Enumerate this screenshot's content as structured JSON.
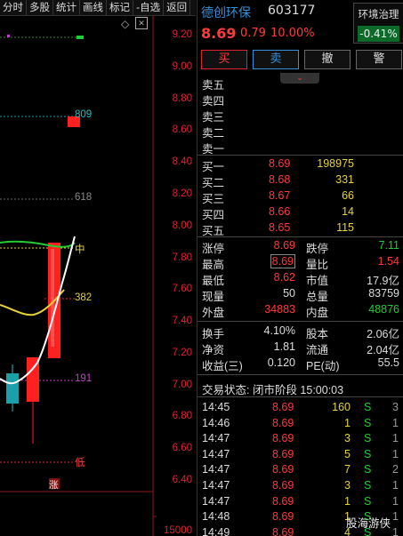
{
  "toolbar": {
    "items": [
      "分时",
      "多股",
      "统计",
      "画线",
      "标记",
      "-自选",
      "返回"
    ]
  },
  "chart": {
    "price_ticks": [
      "9.20",
      "9.00",
      "8.80",
      "8.60",
      "8.40",
      "8.20",
      "8.00",
      "7.80",
      "7.60",
      "7.40",
      "7.20",
      "7.00",
      "6.80",
      "6.60",
      "6.40"
    ],
    "level_labels": {
      "l809": "809",
      "l618": "618",
      "l382": "382",
      "l191": "191",
      "mid": "中",
      "low": "低",
      "rise": "涨"
    },
    "volume_scale": "15000",
    "colors": {
      "up": "#ff2020",
      "down": "#20c0c0",
      "ma_white": "#ffffff",
      "ma_yellow": "#e6d23a",
      "ma_green": "#22cc33"
    }
  },
  "stock": {
    "name": "德创环保",
    "code": "603177",
    "price": "8.69",
    "change": "0.79",
    "change_pct": "10.00%",
    "sector_name": "环境治理",
    "sector_pct": "-0.41%"
  },
  "actions": {
    "buy": "买",
    "sell": "卖",
    "cancel": "撤",
    "alert": "警"
  },
  "order_book": {
    "asks": [
      {
        "label": "卖五",
        "price": "",
        "vol": ""
      },
      {
        "label": "卖四",
        "price": "",
        "vol": ""
      },
      {
        "label": "卖三",
        "price": "",
        "vol": ""
      },
      {
        "label": "卖二",
        "price": "",
        "vol": ""
      },
      {
        "label": "卖一",
        "price": "",
        "vol": ""
      }
    ],
    "bids": [
      {
        "label": "买一",
        "price": "8.69",
        "vol": "198975"
      },
      {
        "label": "买二",
        "price": "8.68",
        "vol": "331"
      },
      {
        "label": "买三",
        "price": "8.67",
        "vol": "66"
      },
      {
        "label": "买四",
        "price": "8.66",
        "vol": "14"
      },
      {
        "label": "买五",
        "price": "8.65",
        "vol": "115"
      }
    ]
  },
  "stats": [
    {
      "l1": "涨停",
      "v1": "8.69",
      "l2": "跌停",
      "v2": "7.11"
    },
    {
      "l1": "最高",
      "v1": "8.69",
      "l2": "量比",
      "v2": "1.54"
    },
    {
      "l1": "最低",
      "v1": "8.62",
      "l2": "市值",
      "v2": "17.9亿"
    },
    {
      "l1": "现量",
      "v1": "50",
      "l2": "总量",
      "v2": "83759"
    },
    {
      "l1": "外盘",
      "v1": "34883",
      "l2": "内盘",
      "v2": "48876"
    }
  ],
  "stats2": [
    {
      "l1": "换手",
      "v1": "4.10%",
      "l2": "股本",
      "v2": "2.06亿"
    },
    {
      "l1": "净资",
      "v1": "1.81",
      "l2": "流通",
      "v2": "2.04亿"
    },
    {
      "l1": "收益(三)",
      "v1": "0.120",
      "l2": "PE(动)",
      "v2": "55.5"
    }
  ],
  "trade_status": "交易状态: 闭市阶段 15:00:03",
  "ticks": [
    {
      "time": "14:45",
      "price": "8.69",
      "vol": "160",
      "side": "S",
      "n": "3"
    },
    {
      "time": "14:46",
      "price": "8.69",
      "vol": "1",
      "side": "S",
      "n": "1"
    },
    {
      "time": "14:47",
      "price": "8.69",
      "vol": "3",
      "side": "S",
      "n": "1"
    },
    {
      "time": "14:47",
      "price": "8.69",
      "vol": "5",
      "side": "S",
      "n": "1"
    },
    {
      "time": "14:47",
      "price": "8.69",
      "vol": "7",
      "side": "S",
      "n": "2"
    },
    {
      "time": "14:47",
      "price": "8.69",
      "vol": "3",
      "side": "S",
      "n": "1"
    },
    {
      "time": "14:47",
      "price": "8.69",
      "vol": "1",
      "side": "S",
      "n": "1"
    },
    {
      "time": "14:48",
      "price": "8.69",
      "vol": "1",
      "side": "S",
      "n": "1"
    },
    {
      "time": "14:49",
      "price": "8.69",
      "vol": "4",
      "side": "S",
      "n": "1"
    }
  ],
  "watermark": "股海游侠"
}
